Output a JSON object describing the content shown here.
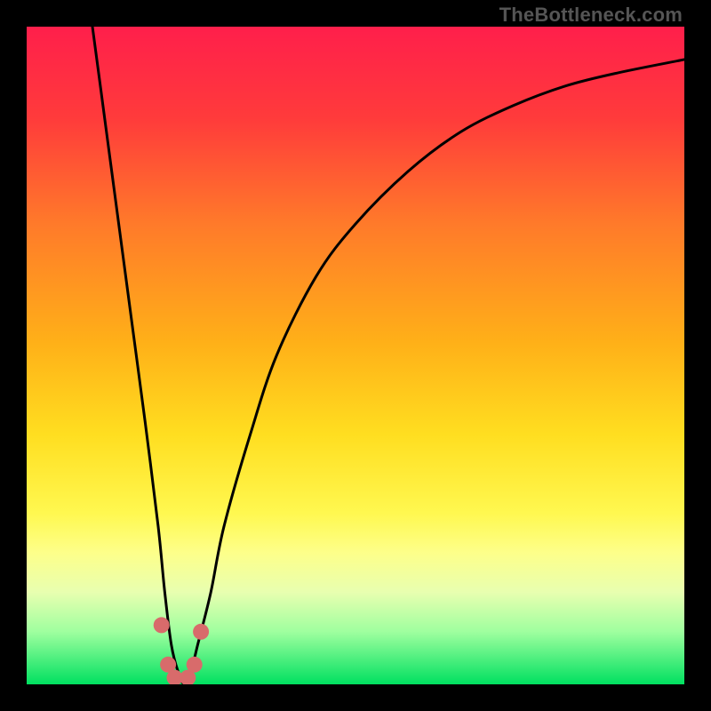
{
  "watermark": "TheBottleneck.com",
  "chart_data": {
    "type": "line",
    "title": "",
    "xlabel": "",
    "ylabel": "",
    "xlim": [
      0,
      100
    ],
    "ylim": [
      0,
      100
    ],
    "grid": false,
    "legend": false,
    "gradient_stops": [
      {
        "pct": 0,
        "color": "#ff1f4b"
      },
      {
        "pct": 14,
        "color": "#ff3b3b"
      },
      {
        "pct": 30,
        "color": "#ff7a2a"
      },
      {
        "pct": 48,
        "color": "#ffb018"
      },
      {
        "pct": 62,
        "color": "#ffde20"
      },
      {
        "pct": 74,
        "color": "#fff850"
      },
      {
        "pct": 80,
        "color": "#fdff8a"
      },
      {
        "pct": 86,
        "color": "#e8ffb0"
      },
      {
        "pct": 92,
        "color": "#9fff9f"
      },
      {
        "pct": 100,
        "color": "#00e060"
      }
    ],
    "series": [
      {
        "name": "bottleneck-curve",
        "x": [
          10,
          12,
          14,
          16,
          18,
          20,
          21,
          22,
          23,
          24,
          25,
          26,
          28,
          30,
          34,
          38,
          44,
          50,
          58,
          66,
          74,
          82,
          90,
          100
        ],
        "y": [
          100,
          85,
          70,
          55,
          40,
          24,
          14,
          6,
          2,
          0,
          2,
          6,
          14,
          24,
          38,
          50,
          62,
          70,
          78,
          84,
          88,
          91,
          93,
          95
        ]
      }
    ],
    "markers": {
      "name": "highlight-points",
      "color": "#d86b6b",
      "points": [
        {
          "x": 20.5,
          "y": 9
        },
        {
          "x": 21.5,
          "y": 3
        },
        {
          "x": 22.5,
          "y": 1
        },
        {
          "x": 24.5,
          "y": 1
        },
        {
          "x": 25.5,
          "y": 3
        },
        {
          "x": 26.5,
          "y": 8
        }
      ]
    }
  }
}
